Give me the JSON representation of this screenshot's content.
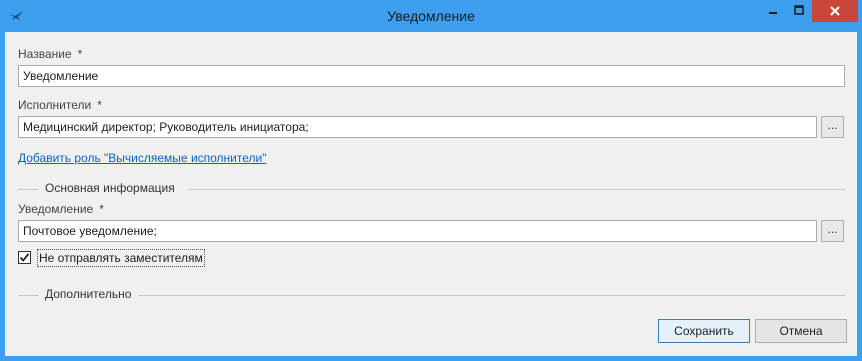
{
  "window": {
    "title": "Уведомление"
  },
  "form": {
    "name": {
      "label": "Название",
      "required_mark": "*",
      "value": "Уведомление"
    },
    "performers": {
      "label": "Исполнители",
      "required_mark": "*",
      "value": "Медицинский директор; Руководитель инициатора;",
      "browse_label": "..."
    },
    "add_role_link": "Добавить роль \"Вычисляемые исполнители\"",
    "basic_info_group": "Основная информация",
    "notification": {
      "label": "Уведомление",
      "required_mark": "*",
      "value": "Почтовое уведомление;",
      "browse_label": "..."
    },
    "no_deputies": {
      "label": "Не отправлять заместителям",
      "checked": true
    },
    "additional_group": "Дополнительно"
  },
  "footer": {
    "save_label": "Сохранить",
    "cancel_label": "Отмена"
  },
  "colors": {
    "titlebar": "#3e9ff0",
    "close_button": "#c8473a",
    "client_bg": "#f0f0f0",
    "link": "#0b63c5"
  }
}
